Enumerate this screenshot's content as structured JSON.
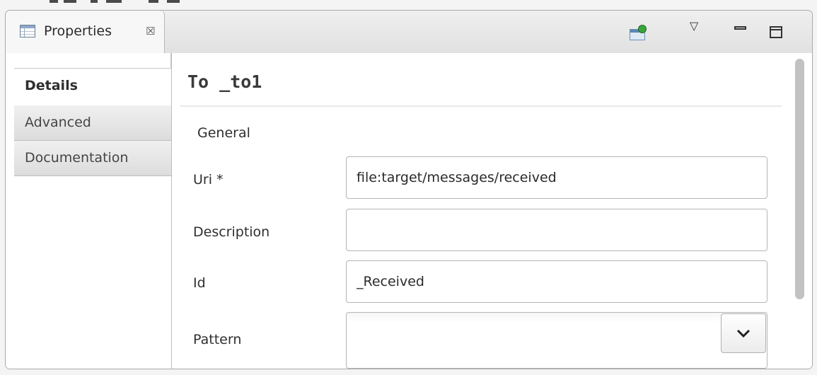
{
  "view": {
    "tab_label": "Properties",
    "tab_close_glyph": "☒",
    "toolbar": {
      "pin_icon": "pin-editor-icon",
      "menu_glyph": "▽",
      "minimize_icon": "minimize-icon",
      "maximize_icon": "maximize-icon"
    }
  },
  "sidetabs": {
    "items": [
      {
        "label": "Details",
        "active": true
      },
      {
        "label": "Advanced",
        "active": false
      },
      {
        "label": "Documentation",
        "active": false
      }
    ]
  },
  "content": {
    "title": "To _to1",
    "section": "General",
    "fields": {
      "uri": {
        "label": "Uri *",
        "value": "file:target/messages/received"
      },
      "description": {
        "label": "Description",
        "value": ""
      },
      "id": {
        "label": "Id",
        "value": "_Received"
      },
      "pattern": {
        "label": "Pattern",
        "value": ""
      }
    }
  },
  "colors": {
    "panel_bg": "#e4e4e4",
    "border": "#a9a9a9",
    "scroll_thumb": "#c2c2c2"
  }
}
